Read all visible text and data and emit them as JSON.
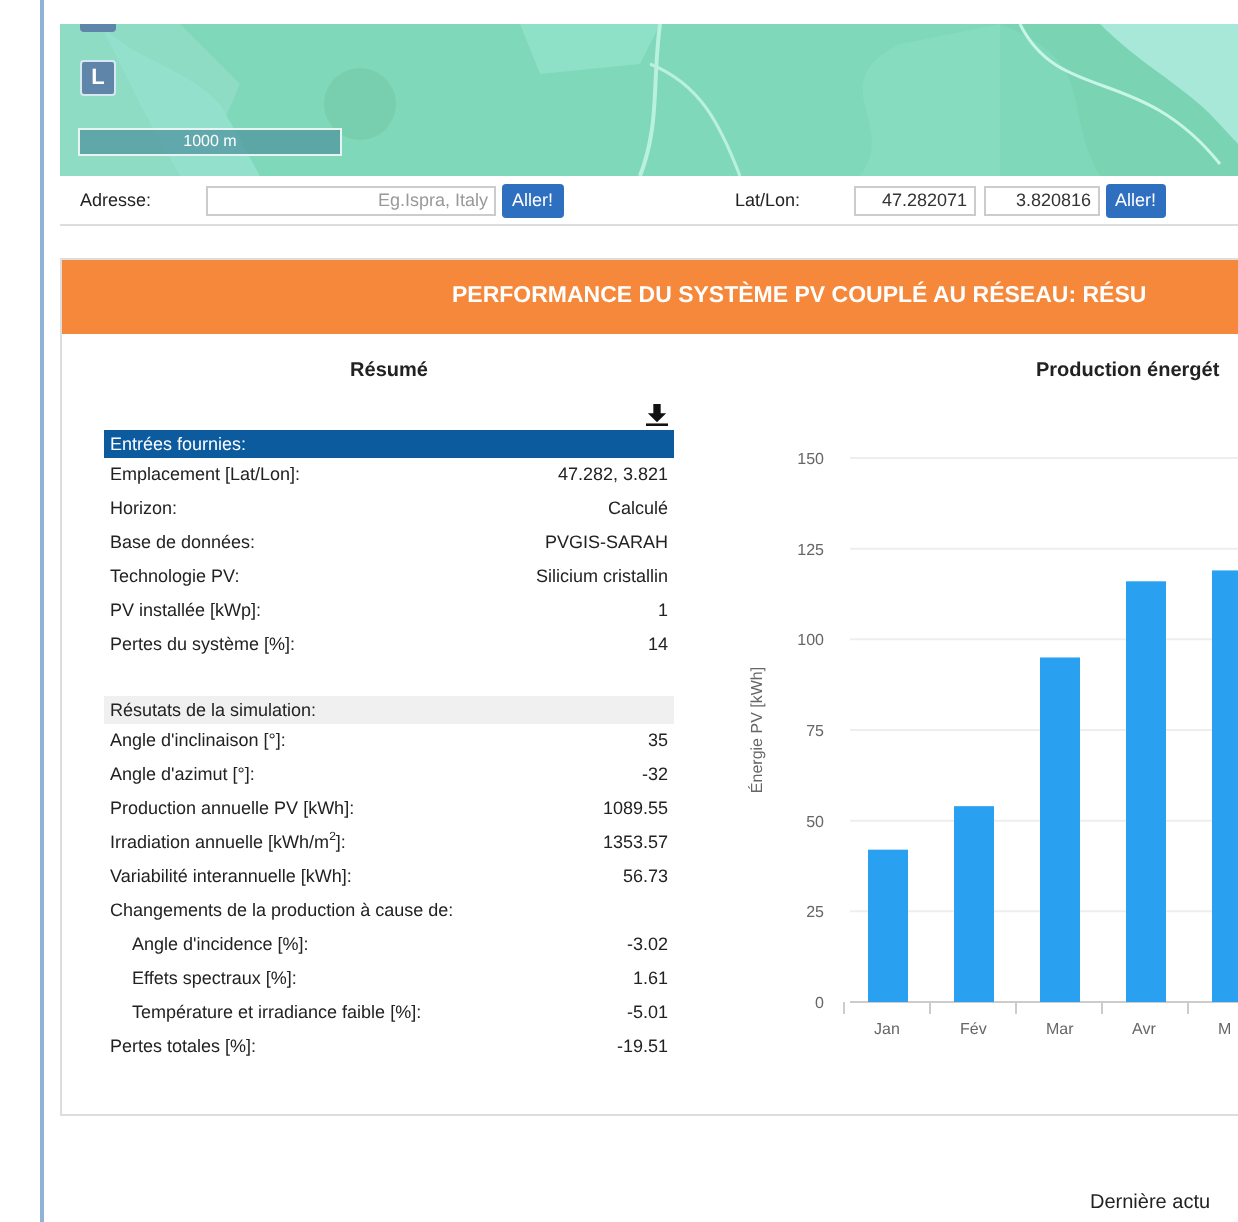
{
  "map": {
    "layer_button": "L",
    "scale": "1000 m"
  },
  "address": {
    "label": "Adresse:",
    "placeholder": "Eg.Ispra, Italy",
    "button": "Aller!"
  },
  "latlon": {
    "label": "Lat/Lon:",
    "lat": "47.282071",
    "lon": "3.820816",
    "button": "Aller!"
  },
  "panel": {
    "title": "PERFORMANCE DU SYSTÈME PV COUPLÉ AU RÉSEAU: RÉSU",
    "summary": {
      "title": "Résumé",
      "sections": [
        {
          "kind": "inputs",
          "title": "Entrées fournies:",
          "rows": [
            {
              "label": "Emplacement [Lat/Lon]:",
              "value": "47.282, 3.821"
            },
            {
              "label": "Horizon:",
              "value": "Calculé"
            },
            {
              "label": "Base de données:",
              "value": "PVGIS-SARAH"
            },
            {
              "label": "Technologie PV:",
              "value": "Silicium cristallin"
            },
            {
              "label": "PV installée [kWp]:",
              "value": "1"
            },
            {
              "label": "Pertes du système [%]:",
              "value": "14"
            }
          ]
        },
        {
          "kind": "results",
          "title": "Résutats de la simulation:",
          "rows": [
            {
              "label": "Angle d'inclinaison [°]:",
              "value": "35"
            },
            {
              "label": "Angle d'azimut [°]:",
              "value": "-32"
            },
            {
              "label": "Production annuelle PV [kWh]:",
              "value": "1089.55"
            },
            {
              "label": "Irradiation annuelle [kWh/m$^{2}$]:",
              "value": "1353.57"
            },
            {
              "label": "Variabilité interannuelle [kWh]:",
              "value": "56.73"
            },
            {
              "label": "Changements de la production à cause de:",
              "children": [
                {
                  "label": "Angle d'incidence [%]:",
                  "value": "-3.02"
                },
                {
                  "label": "Effets spectraux [%]:",
                  "value": "1.61"
                },
                {
                  "label": "Température et irradiance faible [%]:",
                  "value": "-5.01"
                }
              ]
            },
            {
              "label": "Pertes totales [%]:",
              "value": "-19.51"
            }
          ]
        }
      ]
    },
    "chart": {
      "chart_data": {
        "type": "bar",
        "title": "Production énergét",
        "ylabel": "Énergie PV [kWh]",
        "categories": [
          "Jan",
          "Fév",
          "Mar",
          "Avr",
          "M"
        ],
        "values": [
          42,
          54,
          95,
          116,
          119
        ],
        "ylim": [
          0,
          150
        ],
        "grid": true,
        "yticks": [
          0,
          25,
          50,
          75,
          100,
          125,
          150
        ]
      }
    }
  },
  "footer": "Dernière actu"
}
